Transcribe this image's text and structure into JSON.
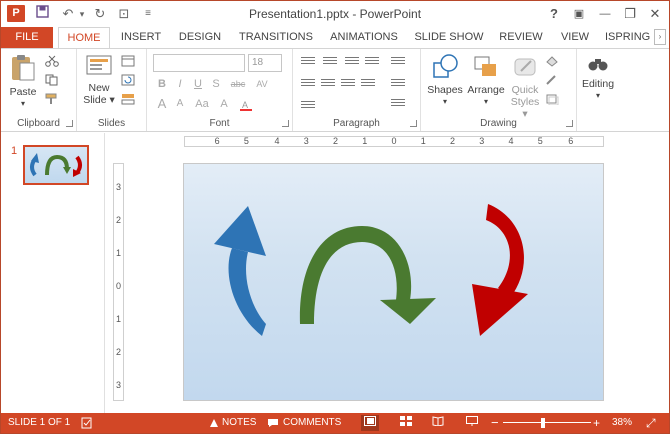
{
  "window": {
    "title": "Presentation1.pptx - PowerPoint",
    "app_icon": "P",
    "controls": {
      "help": "?",
      "ribbon_display": "▣",
      "minimize": "—",
      "restore": "❐",
      "close": "✕"
    }
  },
  "qat": {
    "save": "💾",
    "undo": "↶",
    "undo_drop": "▾",
    "redo": "↻",
    "present": "⊡",
    "customize": "≡"
  },
  "tabs": {
    "file": "FILE",
    "items": [
      "HOME",
      "INSERT",
      "DESIGN",
      "TRANSITIONS",
      "ANIMATIONS",
      "SLIDE SHOW",
      "REVIEW",
      "VIEW",
      "ISPRING F"
    ],
    "active": "HOME",
    "scroll": "›"
  },
  "ribbon": {
    "clipboard": {
      "label": "Clipboard",
      "paste": "Paste",
      "paste_arrow": "▾"
    },
    "slides": {
      "label": "Slides",
      "new_slide_line1": "New",
      "new_slide_line2": "Slide ▾"
    },
    "font": {
      "label": "Font",
      "font_name": "",
      "font_size": "18",
      "bold": "B",
      "italic": "I",
      "underline": "U",
      "shadow": "S",
      "strike": "abc",
      "spacing": "AV",
      "grow": "A",
      "shrink": "A",
      "case": "Aa",
      "clear": "A"
    },
    "paragraph": {
      "label": "Paragraph"
    },
    "drawing": {
      "label": "Drawing",
      "shapes_line1": "Shapes",
      "shapes_line2": "▾",
      "arrange_line1": "Arrange",
      "arrange_line2": "▾",
      "quick_line1": "Quick",
      "quick_line2": "Styles ▾"
    },
    "editing": {
      "label": "Editing",
      "button": "Editing",
      "arrow": "▾"
    }
  },
  "slide_panel": {
    "slide_number": "1"
  },
  "rulers": {
    "horizontal": [
      "6",
      "5",
      "4",
      "3",
      "2",
      "1",
      "0",
      "1",
      "2",
      "3",
      "4",
      "5",
      "6"
    ],
    "vertical": [
      "3",
      "2",
      "1",
      "0",
      "1",
      "2",
      "3"
    ]
  },
  "colors": {
    "accent": "#d24726",
    "blue_arrow": "#2e74b5",
    "green_arrow": "#4a7a30",
    "red_arrow": "#c00000"
  },
  "status": {
    "slide_info": "SLIDE 1 OF 1",
    "notes": "NOTES",
    "comments": "COMMENTS",
    "zoom_minus": "−",
    "zoom_plus": "+",
    "zoom_level": "38%",
    "fit": "⤢",
    "zoom_fraction": 0.45
  }
}
